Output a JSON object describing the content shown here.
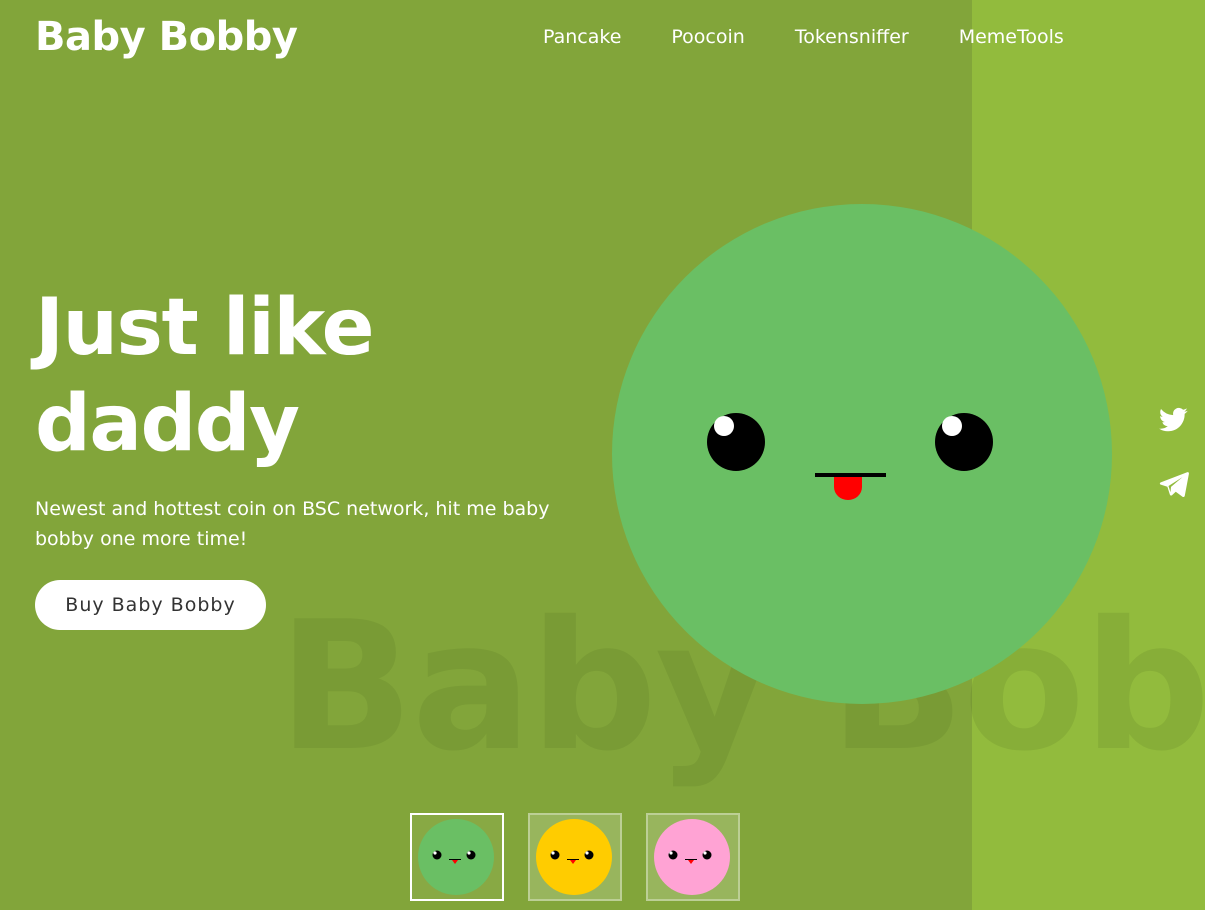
{
  "header": {
    "brand": "Baby Bobby",
    "nav": [
      {
        "label": "Pancake"
      },
      {
        "label": "Poocoin"
      },
      {
        "label": "Tokensniffer"
      },
      {
        "label": "MemeTools"
      }
    ]
  },
  "hero": {
    "headline_line1": "Just like",
    "headline_line2": "daddy",
    "description": "Newest and hottest coin on BSC network, hit me baby bobby one more time!",
    "cta_label": "Buy Baby Bobby",
    "watermark": "Baby Bobby"
  },
  "mascot": {
    "face_color": "#6abf64",
    "tongue_color": "#ff0000"
  },
  "social": [
    {
      "icon": "twitter-icon"
    },
    {
      "icon": "telegram-icon"
    }
  ],
  "variants": [
    {
      "color": "#6abf64",
      "active": true
    },
    {
      "color": "#ffcc00",
      "active": false
    },
    {
      "color": "#ffa3d4",
      "active": false
    }
  ],
  "colors": {
    "background": "#82a53a",
    "right_panel": "#92bb3d"
  }
}
